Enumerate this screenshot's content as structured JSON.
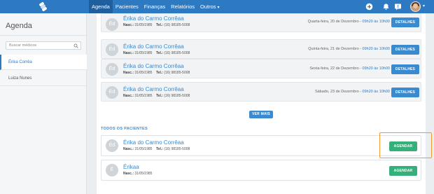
{
  "nav": {
    "items": [
      "Agenda",
      "Pacientes",
      "Finanças",
      "Relatórios",
      "Outros"
    ],
    "active": "Agenda"
  },
  "sidebar": {
    "title": "Agenda",
    "search_placeholder": "Buscar médicos",
    "doctors": [
      {
        "name": "Érika Corrêa",
        "active": true
      },
      {
        "name": "Luiza Nunes",
        "active": false
      }
    ]
  },
  "appointments": [
    {
      "initials": "Éd",
      "name": "Érika do Carmo Corrêaa",
      "nasc_label": "Nasc.:",
      "nasc": "31/05/1985",
      "tel_label": "Tel.:",
      "tel": "(16) 98185-5008",
      "date": "Quarta-feira, 20 de Dezembro - ",
      "time": "09h20 às 10h00",
      "button": "DETALHES"
    },
    {
      "initials": "Éd",
      "name": "Érika do Carmo Corrêaa",
      "nasc_label": "Nasc.:",
      "nasc": "31/05/1985",
      "tel_label": "Tel.:",
      "tel": "(16) 98185-5008",
      "date": "Quinta-feira, 21 de Dezembro - ",
      "time": "09h20 às 10h00",
      "button": "DETALHES"
    },
    {
      "initials": "Éd",
      "name": "Érika do Carmo Corrêaa",
      "nasc_label": "Nasc.:",
      "nasc": "31/05/1985",
      "tel_label": "Tel.:",
      "tel": "(16) 98185-5008",
      "date": "Sexta-feira, 22 de Dezembro - ",
      "time": "09h20 às 10h00",
      "button": "DETALHES"
    },
    {
      "initials": "Éd",
      "name": "Érika do Carmo Corrêaa",
      "nasc_label": "Nasc.:",
      "nasc": "31/05/1985",
      "tel_label": "Tel.:",
      "tel": "(16) 98185-5008",
      "date": "Sábado, 23 de Dezembro - ",
      "time": "09h20 às 10h00",
      "button": "DETALHES"
    }
  ],
  "see_more": "VER MAIS",
  "all_patients": {
    "title": "TODOS OS PACIENTES",
    "patients": [
      {
        "initials": "Éd",
        "name": "Érika do Carmo Corrêaa",
        "nasc_label": "Nasc.:",
        "nasc": "31/05/1985",
        "tel_label": "Tel.:",
        "tel": "(16) 98185-5008",
        "button": "AGENDAR"
      },
      {
        "initials": "É",
        "name": "Érikaa",
        "nasc_label": "Nasc.:",
        "nasc": "31/05/1985",
        "button": "AGENDAR"
      }
    ]
  },
  "colors": {
    "primary": "#2d79c2",
    "link": "#3a8ad0",
    "success": "#35b07a",
    "highlight": "#f29a2e"
  }
}
